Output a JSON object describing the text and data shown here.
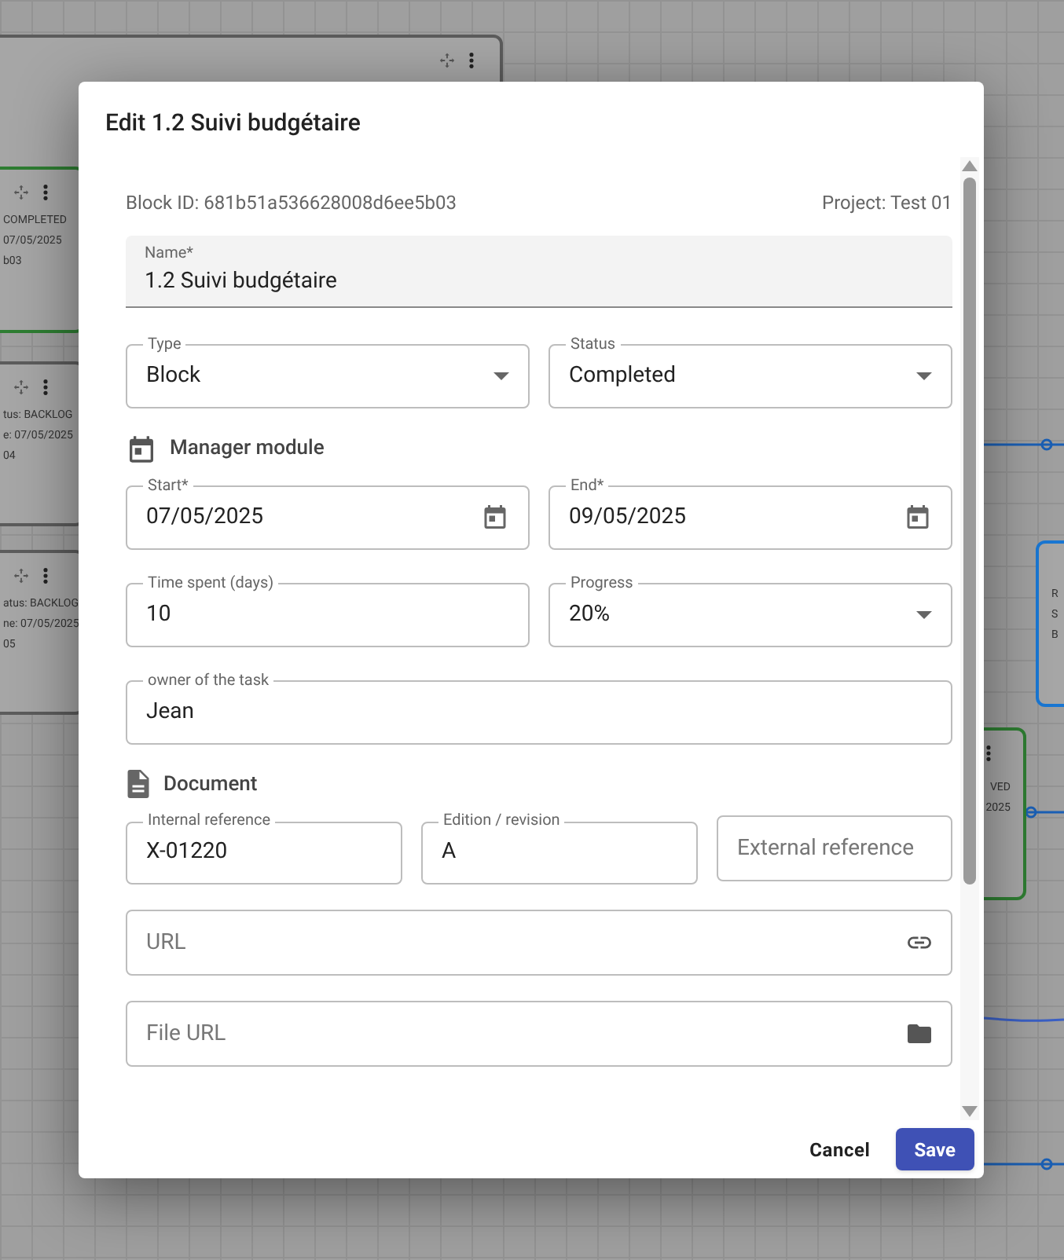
{
  "background": {
    "nodes": [
      {
        "color": "#5c5c5c"
      },
      {
        "color": "#2e7d32",
        "lines": [
          "COMPLETED",
          "07/05/2025",
          "b03"
        ]
      },
      {
        "color": "#5c5c5c",
        "lines": [
          "tus: BACKLOG",
          "e: 07/05/2025",
          "04"
        ]
      },
      {
        "color": "#5c5c5c",
        "lines": [
          "atus: BACKLOG",
          "ne: 07/05/2025",
          "05"
        ]
      },
      {
        "color": "#1976d2",
        "lines": [
          "R",
          "S",
          "B"
        ]
      },
      {
        "color": "#2e7d32",
        "lines": [
          "VED",
          "2025"
        ]
      }
    ]
  },
  "dialog": {
    "title": "Edit 1.2 Suivi budgétaire",
    "block_id": "Block ID: 681b51a536628008d6ee5b03",
    "project": "Project: Test 01",
    "name_field": {
      "label": "Name*",
      "value": "1.2 Suivi budgétaire"
    },
    "row_1": [
      {
        "kind": "select",
        "label": "Type",
        "value": "Block"
      },
      {
        "kind": "select",
        "label": "Status",
        "value": "Completed"
      }
    ],
    "manager_section": {
      "title": "Manager module",
      "rows": [
        [
          {
            "kind": "date",
            "label": "Start*",
            "value": "07/05/2025"
          },
          {
            "kind": "date",
            "label": "End*",
            "value": "09/05/2025"
          }
        ],
        [
          {
            "kind": "text",
            "label": "Time spent (days)",
            "value": "10"
          },
          {
            "kind": "select",
            "label": "Progress",
            "value": "20%"
          }
        ],
        [
          {
            "kind": "text",
            "label": "owner of the task",
            "value": "Jean"
          }
        ]
      ]
    },
    "document_section": {
      "title": "Document",
      "rows": [
        [
          {
            "kind": "text",
            "label": "Internal reference",
            "value": "X-01220"
          },
          {
            "kind": "text",
            "label": "Edition / revision",
            "value": "A"
          },
          {
            "kind": "text",
            "placeholder": "External reference"
          }
        ],
        [
          {
            "kind": "link",
            "placeholder": "URL"
          }
        ],
        [
          {
            "kind": "folder",
            "placeholder": "File URL"
          }
        ]
      ]
    },
    "actions": [
      {
        "kind": "text",
        "label": "Cancel"
      },
      {
        "kind": "primary",
        "label": "Save"
      }
    ]
  }
}
